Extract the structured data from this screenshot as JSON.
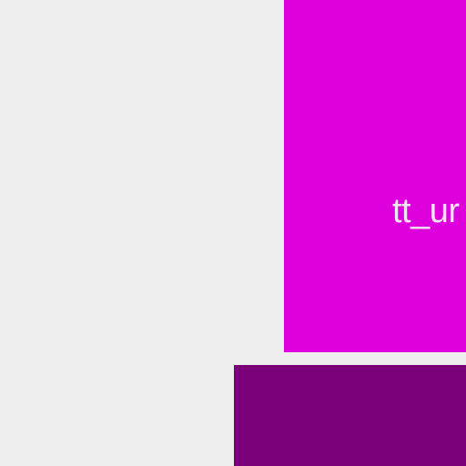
{
  "colors": {
    "background": "#eeeeee",
    "tile_primary": "#dd00dd",
    "tile_primary_text": "#f2e6f2",
    "tile_secondary": "#7a007a"
  },
  "tiles": {
    "primary": {
      "label": "tt_ur"
    }
  }
}
